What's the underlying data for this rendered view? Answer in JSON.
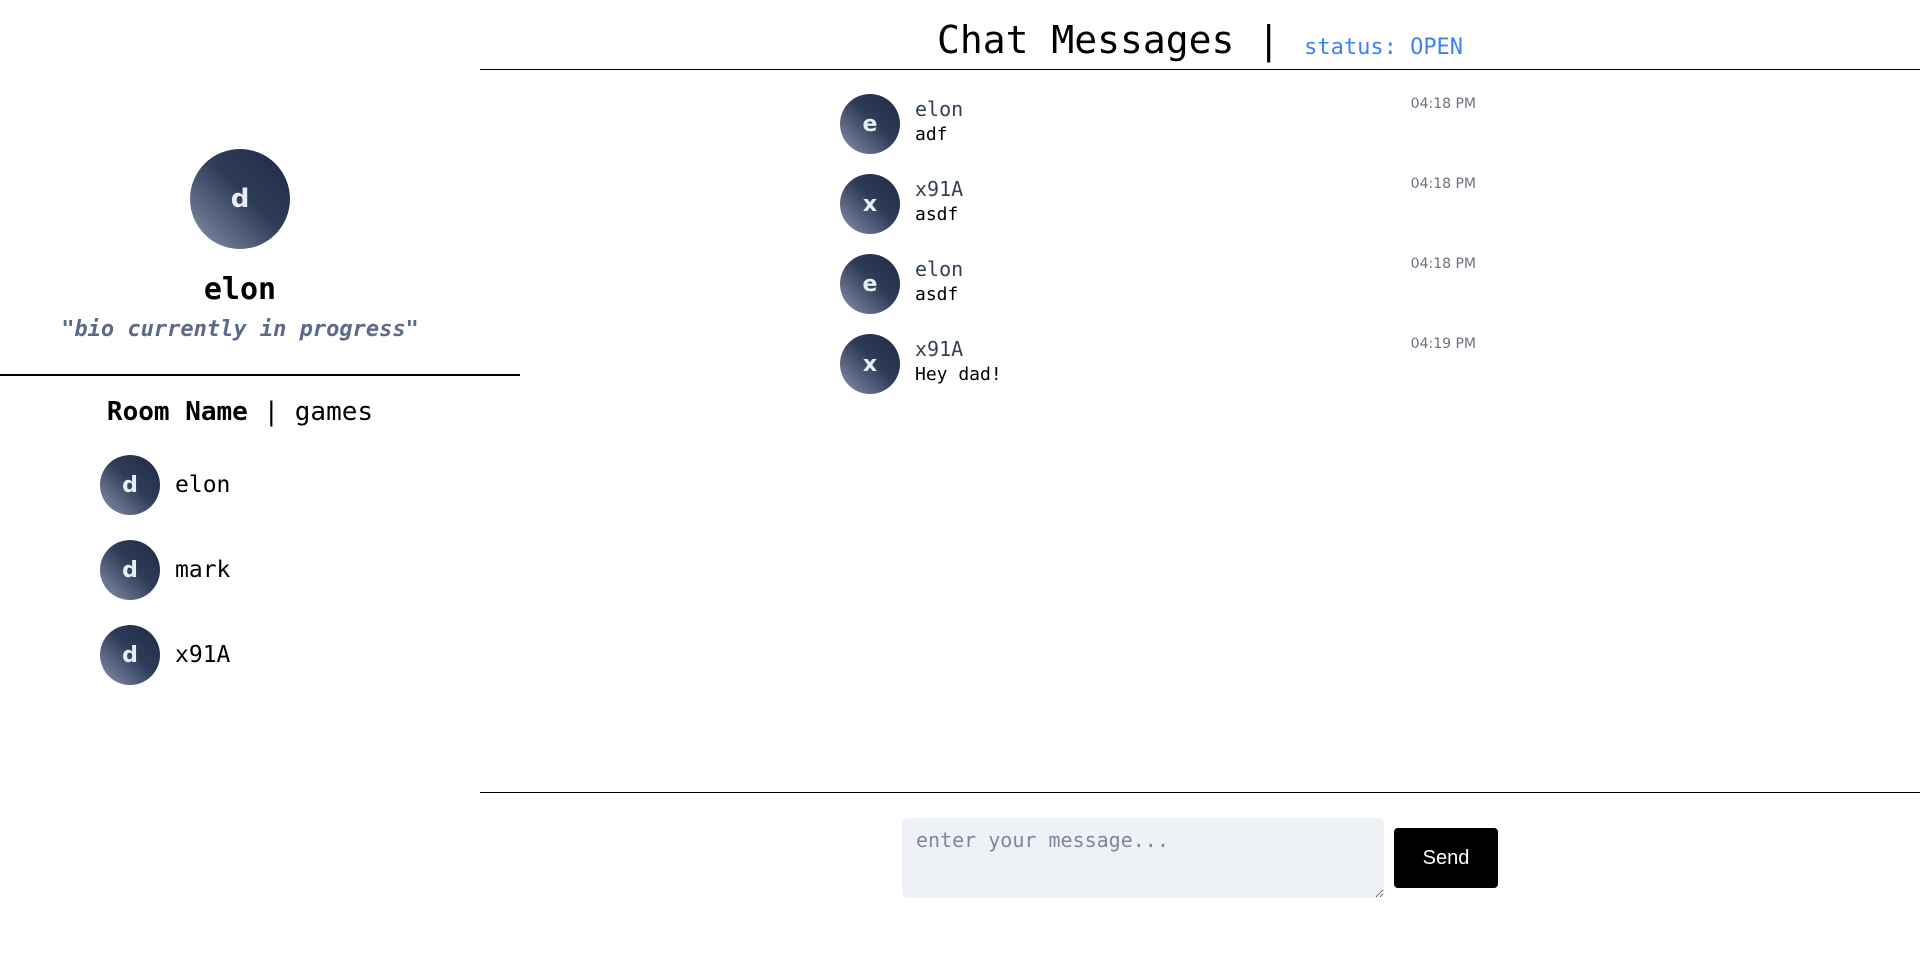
{
  "profile": {
    "avatar_letter": "d",
    "name": "elon",
    "bio": "\"bio currently in progress\""
  },
  "room": {
    "label": "Room Name",
    "separator": "|",
    "name": "games",
    "members": [
      {
        "avatar_letter": "d",
        "name": "elon"
      },
      {
        "avatar_letter": "d",
        "name": "mark"
      },
      {
        "avatar_letter": "d",
        "name": "x91A"
      }
    ]
  },
  "chat": {
    "title": "Chat Messages |",
    "status": "status: OPEN",
    "messages": [
      {
        "avatar_letter": "e",
        "user": "elon",
        "text": "adf",
        "time": "04:18 PM"
      },
      {
        "avatar_letter": "x",
        "user": "x91A",
        "text": "asdf",
        "time": "04:18 PM"
      },
      {
        "avatar_letter": "e",
        "user": "elon",
        "text": "asdf",
        "time": "04:18 PM"
      },
      {
        "avatar_letter": "x",
        "user": "x91A",
        "text": "Hey dad!",
        "time": "04:19 PM"
      }
    ]
  },
  "composer": {
    "placeholder": "enter your message...",
    "send_label": "Send"
  },
  "colors": {
    "status": "#3b82f6",
    "bio": "#5b6a87",
    "input_bg": "#eef2f7",
    "send_bg": "#000000",
    "avatar_dark": "#1f2a44",
    "avatar_light": "#8794ad"
  }
}
